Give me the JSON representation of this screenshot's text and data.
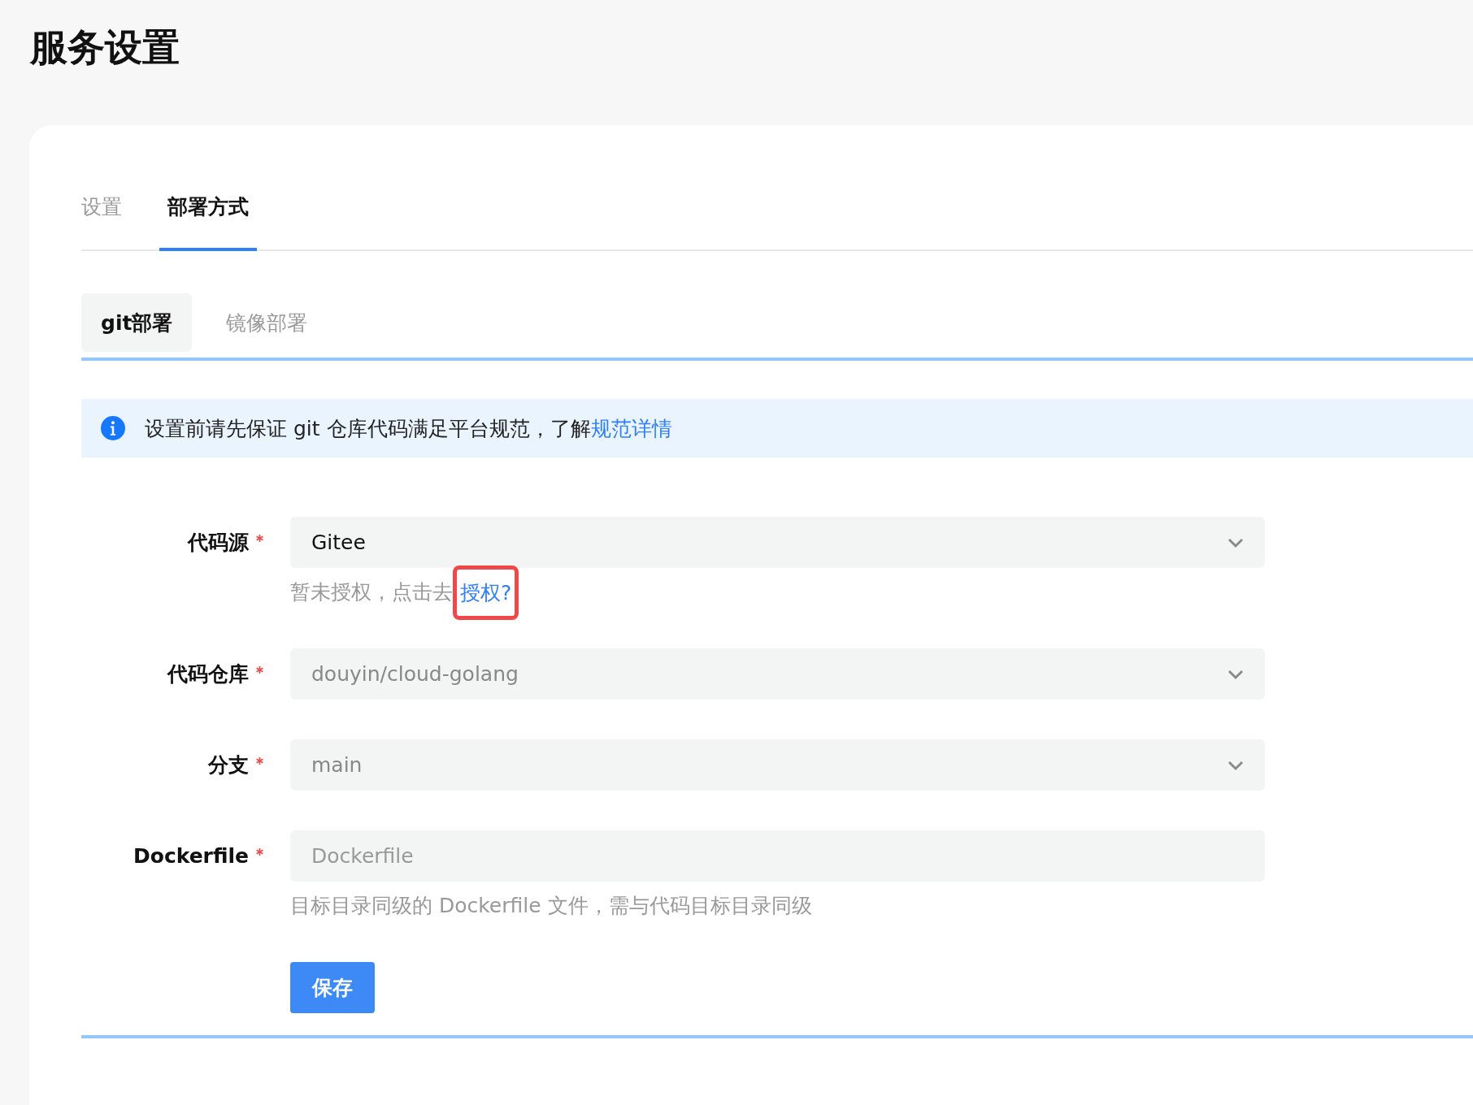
{
  "page_title": "服务设置",
  "tabs": [
    {
      "label": "设置",
      "selected": false
    },
    {
      "label": "部署方式",
      "selected": true
    }
  ],
  "sub_tabs": [
    {
      "label": "git部署",
      "selected": true
    },
    {
      "label": "镜像部署",
      "selected": false
    }
  ],
  "notice": {
    "text": "设置前请先保证 git 仓库代码满足平台规范，了解",
    "link": "规范详情"
  },
  "fields": [
    {
      "label": "代码源",
      "required": true,
      "kind": "select",
      "value": "Gitee",
      "disabled": false,
      "hint": "暂未授权，点击去",
      "hint_link": "授权?",
      "hint_link_highlighted": true
    },
    {
      "label": "代码仓库",
      "required": true,
      "kind": "select",
      "value": "douyin/cloud-golang",
      "disabled": true
    },
    {
      "label": "分支",
      "required": true,
      "kind": "select",
      "value": "main",
      "disabled": true
    },
    {
      "label": "Dockerfile",
      "required": true,
      "kind": "input",
      "placeholder": "Dockerfile",
      "hint": "目标目录同级的 Dockerfile 文件，需与代码目标目录同级"
    }
  ],
  "save_button": "保存"
}
